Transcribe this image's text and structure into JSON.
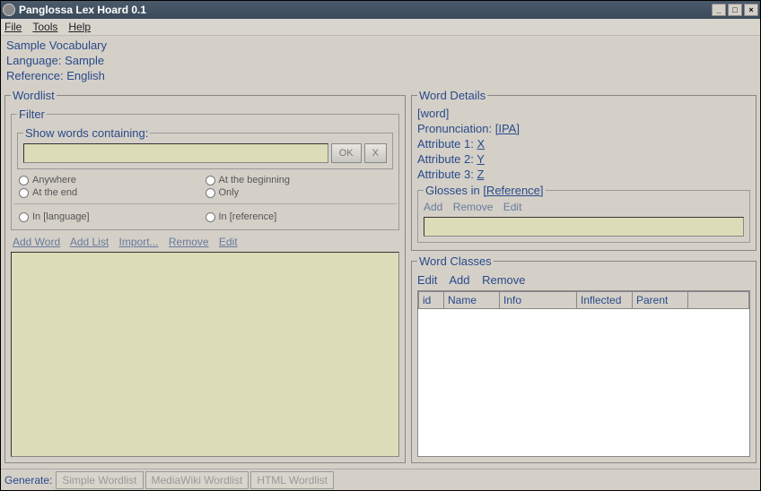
{
  "window": {
    "title": "Panglossa Lex Hoard 0.1"
  },
  "menubar": {
    "file": "File",
    "tools": "Tools",
    "help": "Help"
  },
  "info": {
    "vocab": "Sample Vocabulary",
    "language_label": "Language:",
    "language": "Sample",
    "reference_label": "Reference:",
    "reference": "English"
  },
  "wordlist": {
    "legend": "Wordlist",
    "filter_legend": "Filter",
    "show_legend": "Show words containing:",
    "ok": "OK",
    "x": "X",
    "radios": {
      "anywhere": "Anywhere",
      "atend": "At the end",
      "atbegin": "At the beginning",
      "only": "Only",
      "inlang": "In [language]",
      "inref": "In [reference]"
    },
    "actions": {
      "addword": "Add Word",
      "addlist": "Add List",
      "import": "Import...",
      "remove": "Remove",
      "edit": "Edit"
    }
  },
  "worddetails": {
    "legend": "Word Details",
    "word": "[word]",
    "pron_label": "Pronunciation:",
    "pron": "[IPA]",
    "attr1_label": "Attribute 1:",
    "attr1": "X",
    "attr2_label": "Attribute 2:",
    "attr2": "Y",
    "attr3_label": "Attribute 3:",
    "attr3": "Z",
    "glosses_legend_prefix": "Glosses in ",
    "glosses_ref": "[Reference]",
    "actions": {
      "add": "Add",
      "remove": "Remove",
      "edit": "Edit"
    }
  },
  "wordclasses": {
    "legend": "Word Classes",
    "actions": {
      "edit": "Edit",
      "add": "Add",
      "remove": "Remove"
    },
    "columns": {
      "id": "id",
      "name": "Name",
      "info": "Info",
      "inflected": "Inflected",
      "parent": "Parent"
    }
  },
  "generate": {
    "label": "Generate:",
    "simple": "Simple Wordlist",
    "mediawiki": "MediaWiki Wordlist",
    "html": "HTML Wordlist"
  }
}
